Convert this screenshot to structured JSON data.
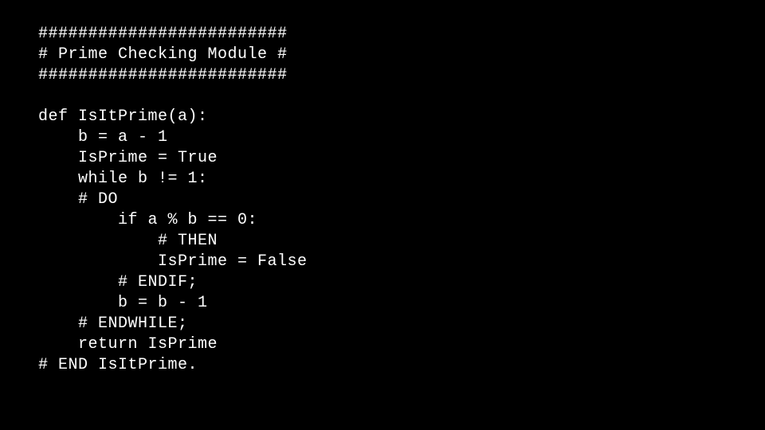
{
  "code": {
    "lines": [
      "#########################",
      "# Prime Checking Module #",
      "#########################",
      "",
      "def IsItPrime(a):",
      "    b = a - 1",
      "    IsPrime = True",
      "    while b != 1:",
      "    # DO",
      "        if a % b == 0:",
      "            # THEN",
      "            IsPrime = False",
      "        # ENDIF;",
      "        b = b - 1",
      "    # ENDWHILE;",
      "    return IsPrime",
      "# END IsItPrime."
    ]
  }
}
